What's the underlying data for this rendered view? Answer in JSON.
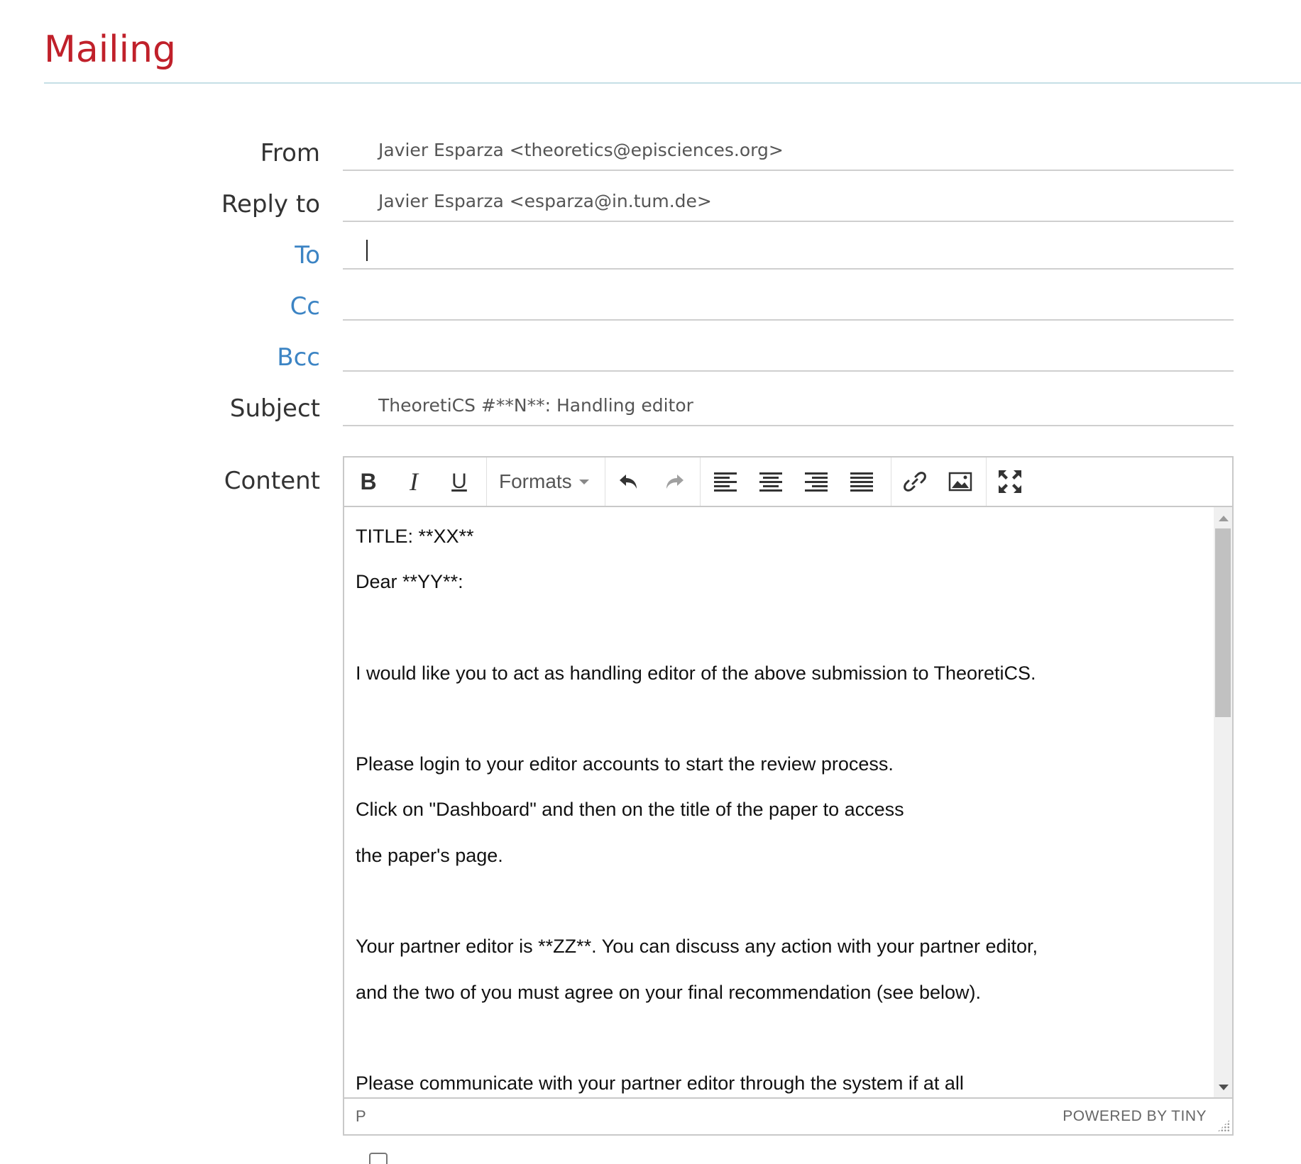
{
  "page": {
    "title": "Mailing"
  },
  "form": {
    "from": {
      "label": "From",
      "value": "Javier Esparza <theoretics@episciences.org>"
    },
    "reply_to": {
      "label": "Reply to",
      "value": "Javier Esparza <esparza@in.tum.de>"
    },
    "to": {
      "label": "To",
      "value": ""
    },
    "cc": {
      "label": "Cc",
      "value": ""
    },
    "bcc": {
      "label": "Bcc",
      "value": ""
    },
    "subject": {
      "label": "Subject",
      "value": "TheoretiCS #**N**: Handling editor"
    },
    "content": {
      "label": "Content"
    }
  },
  "editor": {
    "toolbar": {
      "bold_icon": "bold-icon",
      "italic_icon": "italic-icon",
      "underline_icon": "underline-icon",
      "formats_label": "Formats",
      "undo_icon": "undo-icon",
      "redo_icon": "redo-icon",
      "align_left_icon": "align-left-icon",
      "align_center_icon": "align-center-icon",
      "align_right_icon": "align-right-icon",
      "align_justify_icon": "align-justify-icon",
      "link_icon": "link-icon",
      "image_icon": "image-icon",
      "fullscreen_icon": "fullscreen-icon"
    },
    "lines": [
      "TITLE: **XX**",
      "Dear **YY**:",
      "",
      "I would like you to act as handling editor of the above submission to TheoretiCS.",
      "",
      "Please login to your editor accounts to start the review process.",
      "Click on \"Dashboard\" and then on the title of the paper to access",
      "the paper's page.",
      "",
      "Your partner editor is **ZZ**. You can discuss any action with your partner editor,",
      "and the two of you must agree on your final recommendation (see below).",
      "",
      "Please communicate with your partner editor through the system if at all"
    ],
    "status_path": "P",
    "branding": "POWERED BY TINY"
  },
  "colors": {
    "title": "#c0202a",
    "link_label": "#3c84c4",
    "rule": "#c5dfe6"
  }
}
